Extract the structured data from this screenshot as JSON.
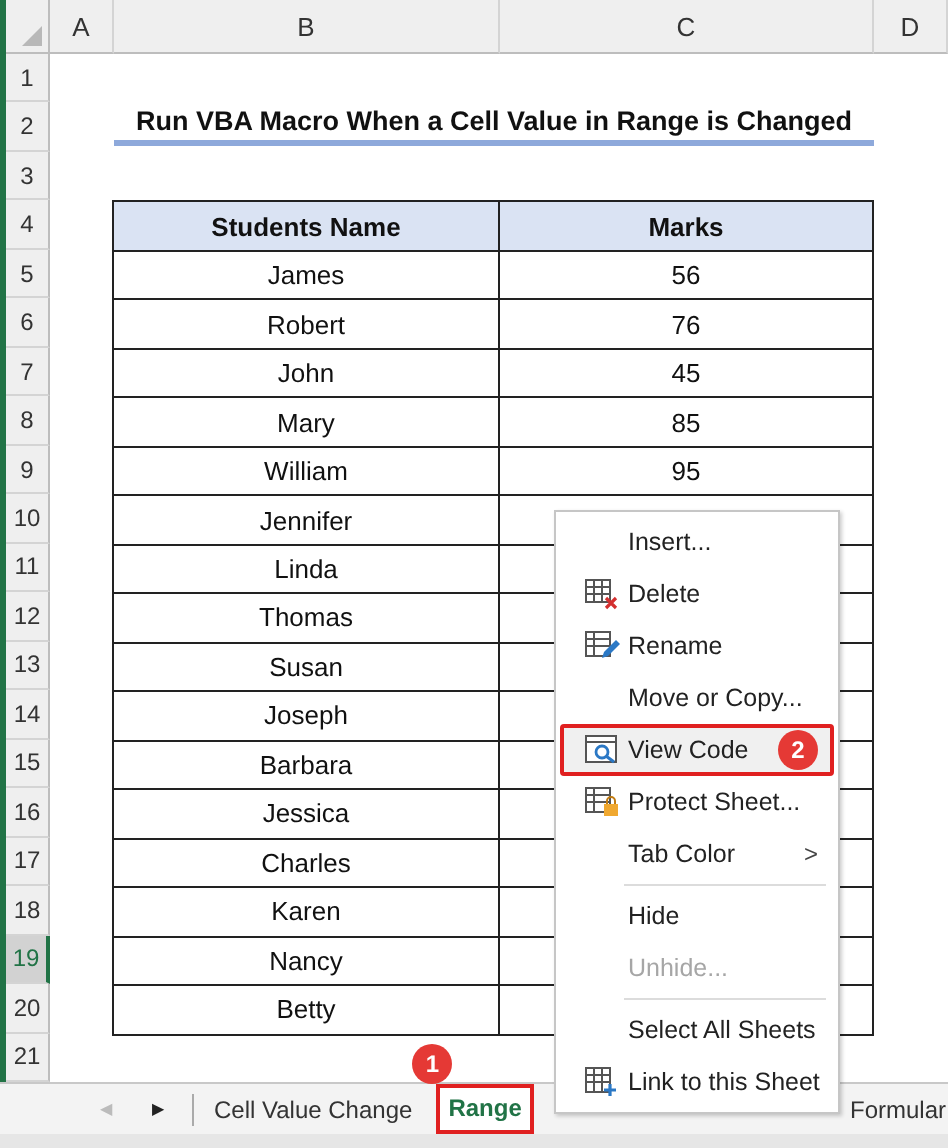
{
  "columns": [
    "A",
    "B",
    "C",
    "D"
  ],
  "row_headers": [
    {
      "label": "1",
      "selected": false
    },
    {
      "label": "2",
      "selected": false
    },
    {
      "label": "3",
      "selected": false
    },
    {
      "label": "4",
      "selected": false
    },
    {
      "label": "5",
      "selected": false
    },
    {
      "label": "6",
      "selected": false
    },
    {
      "label": "7",
      "selected": false
    },
    {
      "label": "8",
      "selected": false
    },
    {
      "label": "9",
      "selected": false
    },
    {
      "label": "10",
      "selected": false
    },
    {
      "label": "11",
      "selected": false
    },
    {
      "label": "12",
      "selected": false
    },
    {
      "label": "13",
      "selected": false
    },
    {
      "label": "14",
      "selected": false
    },
    {
      "label": "15",
      "selected": false
    },
    {
      "label": "16",
      "selected": false
    },
    {
      "label": "17",
      "selected": false
    },
    {
      "label": "18",
      "selected": false
    },
    {
      "label": "19",
      "selected": true
    },
    {
      "label": "20",
      "selected": false
    },
    {
      "label": "21",
      "selected": false
    }
  ],
  "title": "Run VBA Macro When a Cell Value in Range is Changed",
  "table": {
    "columns": [
      "Students Name",
      "Marks"
    ],
    "rows": [
      [
        "James",
        "56"
      ],
      [
        "Robert",
        "76"
      ],
      [
        "John",
        "45"
      ],
      [
        "Mary",
        "85"
      ],
      [
        "William",
        "95"
      ],
      [
        "Jennifer",
        ""
      ],
      [
        "Linda",
        ""
      ],
      [
        "Thomas",
        ""
      ],
      [
        "Susan",
        ""
      ],
      [
        "Joseph",
        ""
      ],
      [
        "Barbara",
        ""
      ],
      [
        "Jessica",
        ""
      ],
      [
        "Charles",
        ""
      ],
      [
        "Karen",
        ""
      ],
      [
        "Nancy",
        ""
      ],
      [
        "Betty",
        ""
      ]
    ]
  },
  "context_menu": [
    {
      "label": "Insert...",
      "kind": "plain",
      "separator_before": false,
      "selected": false,
      "disabled": false
    },
    {
      "label": "Delete",
      "kind": "delete",
      "separator_before": false,
      "selected": false,
      "disabled": false
    },
    {
      "label": "Rename",
      "kind": "rename",
      "separator_before": false,
      "selected": false,
      "disabled": false
    },
    {
      "label": "Move or Copy...",
      "kind": "plain",
      "separator_before": false,
      "selected": false,
      "disabled": false
    },
    {
      "label": "View Code",
      "kind": "code",
      "separator_before": false,
      "selected": true,
      "disabled": false,
      "badge": "2"
    },
    {
      "label": "Protect Sheet...",
      "kind": "protect",
      "separator_before": false,
      "selected": false,
      "disabled": false
    },
    {
      "label": "Tab Color",
      "kind": "plain",
      "separator_before": false,
      "selected": false,
      "disabled": false,
      "arrow": ">"
    },
    {
      "label": "Hide",
      "kind": "plain",
      "separator_before": true,
      "selected": false,
      "disabled": false
    },
    {
      "label": "Unhide...",
      "kind": "plain",
      "separator_before": false,
      "selected": false,
      "disabled": true
    },
    {
      "label": "Select All Sheets",
      "kind": "plain",
      "separator_before": true,
      "selected": false,
      "disabled": false
    },
    {
      "label": "Link to this Sheet",
      "kind": "link",
      "separator_before": false,
      "selected": false,
      "disabled": false
    }
  ],
  "sheet_tabs": {
    "nav": [
      {
        "label": "◀",
        "disabled": true
      },
      {
        "label": "▶",
        "disabled": false
      }
    ],
    "tabs": [
      {
        "label": "Cell Value Change",
        "selected": false
      },
      {
        "label": "Range",
        "selected": true,
        "badge": "1"
      },
      {
        "label": "Formular",
        "selected": false
      }
    ]
  }
}
